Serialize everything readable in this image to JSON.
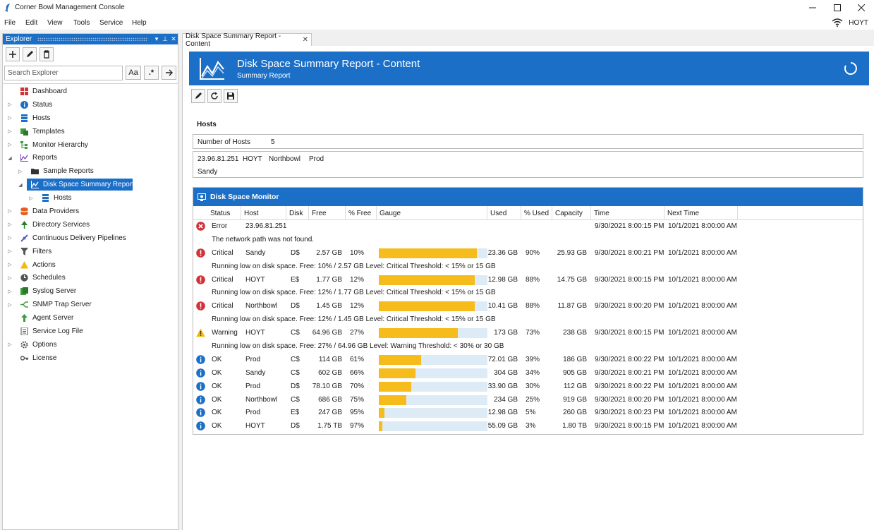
{
  "window": {
    "title": "Corner Bowl Management Console"
  },
  "menu": [
    "File",
    "Edit",
    "View",
    "Tools",
    "Service",
    "Help"
  ],
  "user": {
    "name": "HOYT"
  },
  "explorer": {
    "title": "Explorer",
    "search_placeholder": "Search Explorer",
    "case_button": "Aa",
    "regex_button": ".*",
    "tree": [
      {
        "label": "Dashboard",
        "icon": "dashboard-icon",
        "level": 0,
        "arrow": ""
      },
      {
        "label": "Status",
        "icon": "info-icon",
        "level": 0,
        "arrow": "collapsed"
      },
      {
        "label": "Hosts",
        "icon": "server-icon",
        "level": 0,
        "arrow": "collapsed"
      },
      {
        "label": "Templates",
        "icon": "templates-icon",
        "level": 0,
        "arrow": "collapsed"
      },
      {
        "label": "Monitor Hierarchy",
        "icon": "hierarchy-icon",
        "level": 0,
        "arrow": "collapsed"
      },
      {
        "label": "Reports",
        "icon": "reports-icon",
        "level": 0,
        "arrow": "expanded"
      },
      {
        "label": "Sample Reports",
        "icon": "folder-icon",
        "level": 1,
        "arrow": "collapsed"
      },
      {
        "label": "Disk Space Summary Report",
        "icon": "report-chart-icon",
        "level": 1,
        "arrow": "expanded",
        "selected": true
      },
      {
        "label": "Hosts",
        "icon": "server-icon",
        "level": 2,
        "arrow": "collapsed"
      },
      {
        "label": "Data Providers",
        "icon": "database-icon",
        "level": 0,
        "arrow": "collapsed"
      },
      {
        "label": "Directory Services",
        "icon": "tree-icon",
        "level": 0,
        "arrow": "collapsed"
      },
      {
        "label": "Continuous Delivery Pipelines",
        "icon": "pipeline-icon",
        "level": 0,
        "arrow": "collapsed"
      },
      {
        "label": "Filters",
        "icon": "filter-icon",
        "level": 0,
        "arrow": "collapsed"
      },
      {
        "label": "Actions",
        "icon": "warning-icon",
        "level": 0,
        "arrow": "collapsed"
      },
      {
        "label": "Schedules",
        "icon": "clock-icon",
        "level": 0,
        "arrow": "collapsed"
      },
      {
        "label": "Syslog Server",
        "icon": "syslog-icon",
        "level": 0,
        "arrow": "collapsed"
      },
      {
        "label": "SNMP Trap Server",
        "icon": "snmp-icon",
        "level": 0,
        "arrow": "collapsed"
      },
      {
        "label": "Agent Server",
        "icon": "agent-icon",
        "level": 0,
        "arrow": ""
      },
      {
        "label": "Service Log File",
        "icon": "log-file-icon",
        "level": 0,
        "arrow": ""
      },
      {
        "label": "Options",
        "icon": "gear-icon",
        "level": 0,
        "arrow": "collapsed"
      },
      {
        "label": "License",
        "icon": "key-icon",
        "level": 0,
        "arrow": ""
      }
    ]
  },
  "tab": {
    "label": "Disk Space Summary Report - Content"
  },
  "banner": {
    "title": "Disk Space Summary Report - Content",
    "subtitle": "Summary Report"
  },
  "hosts": {
    "title": "Hosts",
    "count_label": "Number of Hosts",
    "count": "5",
    "list_line1": [
      "23.96.81.251",
      "HOYT",
      "Northbowl",
      "Prod"
    ],
    "list_line2": [
      "Sandy"
    ]
  },
  "monitor": {
    "title": "Disk Space Monitor",
    "columns": [
      "Status",
      "Host",
      "Disk",
      "Free",
      "% Free",
      "Gauge",
      "Used",
      "% Used",
      "Capacity",
      "Time",
      "Next Time"
    ],
    "rows": [
      {
        "type": "error",
        "status": "Error",
        "host": "23.96.81.251",
        "disk": "",
        "free": "",
        "pct_free": "",
        "gauge": null,
        "used": "",
        "pct_used": "",
        "capacity": "",
        "time": "9/30/2021 8:00:15 PM",
        "next": "10/1/2021 8:00:00 AM",
        "message": "The network path was not found."
      },
      {
        "type": "critical",
        "status": "Critical",
        "host": "Sandy",
        "disk": "D$",
        "free": "2.57 GB",
        "pct_free": "10%",
        "gauge": 0.9,
        "used": "23.36 GB",
        "pct_used": "90%",
        "capacity": "25.93 GB",
        "time": "9/30/2021 8:00:21 PM",
        "next": "10/1/2021 8:00:00 AM",
        "message": "Running low on disk space.  Free: 10% / 2.57 GB  Level: Critical  Threshold: < 15% or 15 GB"
      },
      {
        "type": "critical",
        "status": "Critical",
        "host": "HOYT",
        "disk": "E$",
        "free": "1.77 GB",
        "pct_free": "12%",
        "gauge": 0.88,
        "used": "12.98 GB",
        "pct_used": "88%",
        "capacity": "14.75 GB",
        "time": "9/30/2021 8:00:15 PM",
        "next": "10/1/2021 8:00:00 AM",
        "message": "Running low on disk space.  Free: 12% / 1.77 GB  Level: Critical  Threshold: < 15% or 15 GB"
      },
      {
        "type": "critical",
        "status": "Critical",
        "host": "Northbowl",
        "disk": "D$",
        "free": "1.45 GB",
        "pct_free": "12%",
        "gauge": 0.88,
        "used": "10.41 GB",
        "pct_used": "88%",
        "capacity": "11.87 GB",
        "time": "9/30/2021 8:00:20 PM",
        "next": "10/1/2021 8:00:00 AM",
        "message": "Running low on disk space.  Free: 12% / 1.45 GB  Level: Critical  Threshold: < 15% or 15 GB"
      },
      {
        "type": "warning",
        "status": "Warning",
        "host": "HOYT",
        "disk": "C$",
        "free": "64.96 GB",
        "pct_free": "27%",
        "gauge": 0.73,
        "used": "173 GB",
        "pct_used": "73%",
        "capacity": "238 GB",
        "time": "9/30/2021 8:00:15 PM",
        "next": "10/1/2021 8:00:00 AM",
        "message": "Running low on disk space.  Free: 27% / 64.96 GB  Level: Warning  Threshold: < 30% or 30 GB"
      },
      {
        "type": "ok",
        "status": "OK",
        "host": "Prod",
        "disk": "C$",
        "free": "114 GB",
        "pct_free": "61%",
        "gauge": 0.39,
        "used": "72.01 GB",
        "pct_used": "39%",
        "capacity": "186 GB",
        "time": "9/30/2021 8:00:22 PM",
        "next": "10/1/2021 8:00:00 AM"
      },
      {
        "type": "ok",
        "status": "OK",
        "host": "Sandy",
        "disk": "C$",
        "free": "602 GB",
        "pct_free": "66%",
        "gauge": 0.34,
        "used": "304 GB",
        "pct_used": "34%",
        "capacity": "905 GB",
        "time": "9/30/2021 8:00:21 PM",
        "next": "10/1/2021 8:00:00 AM"
      },
      {
        "type": "ok",
        "status": "OK",
        "host": "Prod",
        "disk": "D$",
        "free": "78.10 GB",
        "pct_free": "70%",
        "gauge": 0.3,
        "used": "33.90 GB",
        "pct_used": "30%",
        "capacity": "112 GB",
        "time": "9/30/2021 8:00:22 PM",
        "next": "10/1/2021 8:00:00 AM"
      },
      {
        "type": "ok",
        "status": "OK",
        "host": "Northbowl",
        "disk": "C$",
        "free": "686 GB",
        "pct_free": "75%",
        "gauge": 0.25,
        "used": "234 GB",
        "pct_used": "25%",
        "capacity": "919 GB",
        "time": "9/30/2021 8:00:20 PM",
        "next": "10/1/2021 8:00:00 AM"
      },
      {
        "type": "ok",
        "status": "OK",
        "host": "Prod",
        "disk": "E$",
        "free": "247 GB",
        "pct_free": "95%",
        "gauge": 0.05,
        "used": "12.98 GB",
        "pct_used": "5%",
        "capacity": "260 GB",
        "time": "9/30/2021 8:00:23 PM",
        "next": "10/1/2021 8:00:00 AM"
      },
      {
        "type": "ok",
        "status": "OK",
        "host": "HOYT",
        "disk": "D$",
        "free": "1.75 TB",
        "pct_free": "97%",
        "gauge": 0.03,
        "used": "55.09 GB",
        "pct_used": "3%",
        "capacity": "1.80 TB",
        "time": "9/30/2021 8:00:15 PM",
        "next": "10/1/2021 8:00:00 AM"
      }
    ]
  },
  "colors": {
    "accent": "#1c6fc7",
    "gauge_fill": "#f5bc1c",
    "gauge_track": "#ddebf7",
    "critical": "#d13438",
    "warning": "#f2b90f",
    "info": "#1c6fc7"
  }
}
